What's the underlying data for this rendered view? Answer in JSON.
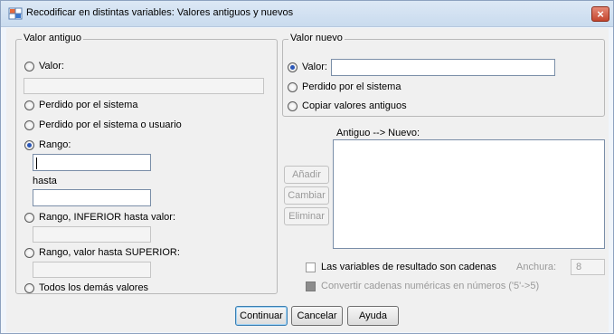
{
  "window": {
    "title": "Recodificar en distintas variables: Valores antiguos y nuevos",
    "close_glyph": "×"
  },
  "old_value": {
    "legend": "Valor antiguo",
    "options": {
      "valor": "Valor:",
      "perdido_sistema": "Perdido por el sistema",
      "perdido_usuario": "Perdido por el sistema o usuario",
      "rango": "Rango:",
      "rango_inferior": "Rango, INFERIOR hasta valor:",
      "rango_superior": "Rango, valor hasta SUPERIOR:",
      "todos": "Todos los demás valores"
    },
    "hasta_label": "hasta",
    "selected": "rango"
  },
  "new_value": {
    "legend": "Valor nuevo",
    "options": {
      "valor": "Valor:",
      "perdido_sistema": "Perdido por el sistema",
      "copiar": "Copiar valores antiguos"
    },
    "selected": "valor"
  },
  "mapping": {
    "label": "Antiguo --> Nuevo:",
    "buttons": {
      "anadir": "Añadir",
      "cambiar": "Cambiar",
      "eliminar": "Eliminar"
    }
  },
  "output_options": {
    "string_vars_label": "Las variables de resultado son cadenas",
    "anchura_label": "Anchura:",
    "anchura_value": "8",
    "convert_label": "Convertir cadenas numéricas en números ('5'->5)"
  },
  "footer": {
    "continuar": "Continuar",
    "cancelar": "Cancelar",
    "ayuda": "Ayuda"
  },
  "colors": {
    "accent": "#2a56b8",
    "close": "#c4462e"
  }
}
